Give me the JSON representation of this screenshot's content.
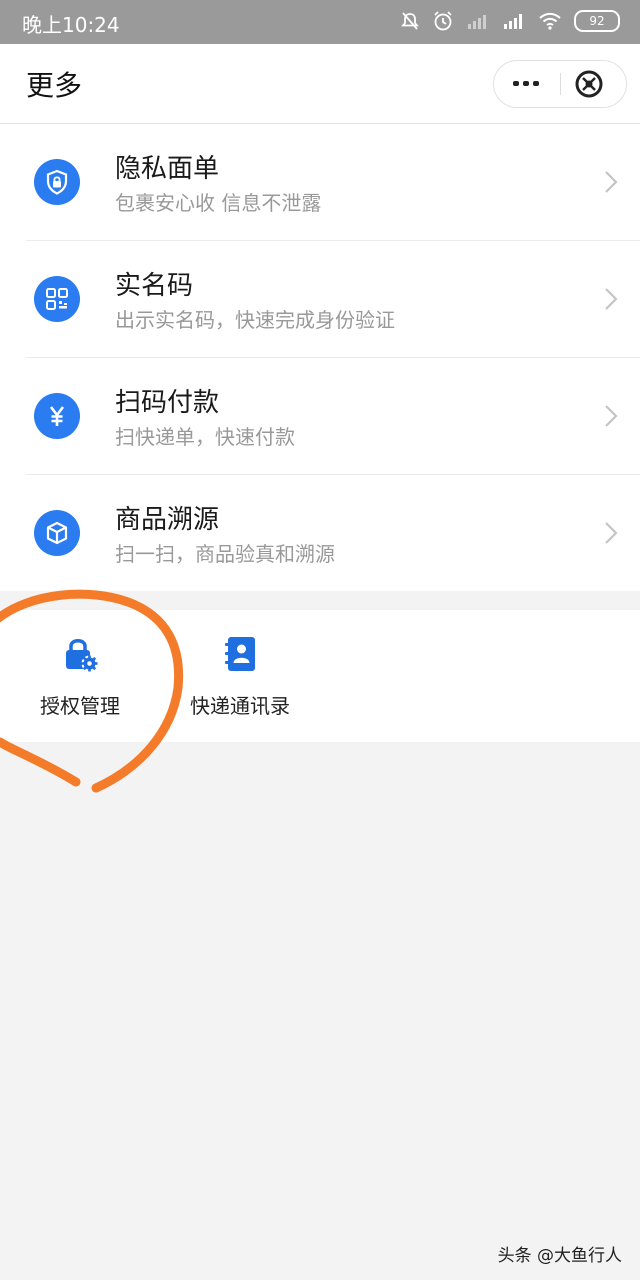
{
  "status_bar": {
    "time": "晚上10:24",
    "battery": "92",
    "icons": [
      "mute-icon",
      "alarm-icon",
      "signal-no-sim-icon",
      "signal-icon",
      "wifi-icon",
      "battery-icon"
    ]
  },
  "header": {
    "title": "更多",
    "more_icon": "more-dots-icon",
    "close_icon": "close-circle-icon"
  },
  "list": [
    {
      "title": "隐私面单",
      "subtitle": "包裹安心收 信息不泄露",
      "icon": "shield-lock-icon"
    },
    {
      "title": "实名码",
      "subtitle": "出示实名码，快速完成身份验证",
      "icon": "qr-code-icon"
    },
    {
      "title": "扫码付款",
      "subtitle": "扫快递单，快速付款",
      "icon": "yen-icon"
    },
    {
      "title": "商品溯源",
      "subtitle": "扫一扫，商品验真和溯源",
      "icon": "box-icon"
    }
  ],
  "grid": [
    {
      "label": "授权管理",
      "icon": "lock-gear-icon"
    },
    {
      "label": "快递通讯录",
      "icon": "contacts-book-icon"
    }
  ],
  "watermark": "头条 @大鱼行人",
  "colors": {
    "accent": "#2a7cf0",
    "annotation": "#f47b2a",
    "status_bar": "#9a9a9a",
    "background": "#f3f3f3"
  }
}
